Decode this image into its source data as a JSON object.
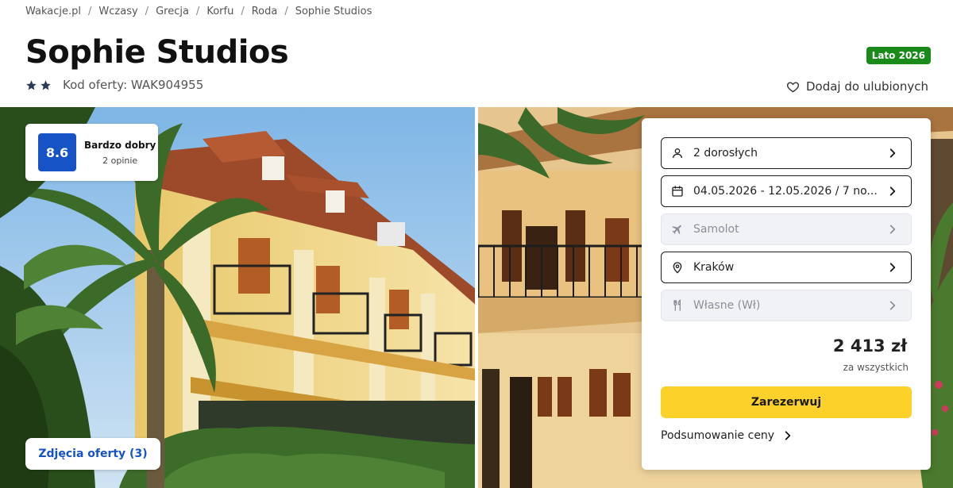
{
  "breadcrumb": [
    "Wakacje.pl",
    "Wczasy",
    "Grecja",
    "Korfu",
    "Roda",
    "Sophie Studios"
  ],
  "breadcrumb_separator": "/",
  "hotel": {
    "name": "Sophie Studios",
    "stars": 2,
    "offer_code": "Kod oferty: WAK904955",
    "season_badge": "Lato 2026",
    "favorite_label": "Dodaj do ulubionych"
  },
  "rating": {
    "score": "8.6",
    "label": "Bardzo dobry",
    "count": "2 opinie"
  },
  "photos_button": "Zdjęcia oferty (3)",
  "booking": {
    "travelers": "2 dorosłych",
    "dates": "04.05.2026 - 12.05.2026 / 7 no...",
    "transport": "Samolot",
    "departure": "Kraków",
    "board": "Własne (Wł)",
    "price": "2 413 zł",
    "price_note": "za wszystkich",
    "book_label": "Zarezerwuj",
    "summary_label": "Podsumowanie ceny"
  },
  "colors": {
    "brand_blue": "#1553c6",
    "book_yellow": "#fcd12a",
    "badge_green": "#1a8a1a",
    "star_navy": "#2b3a55"
  },
  "icons": {
    "travelers": "person-icon",
    "dates": "calendar-icon",
    "transport": "airplane-icon",
    "departure": "location-pin-icon",
    "board": "cutlery-icon",
    "favorite": "heart-icon"
  }
}
